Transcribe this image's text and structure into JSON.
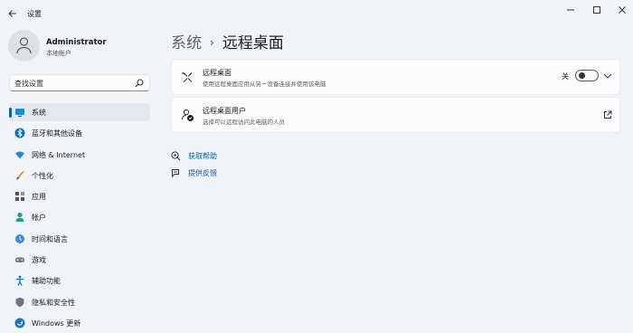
{
  "window": {
    "title": "设置",
    "back_icon": "back-arrow-icon",
    "controls": [
      "minimize-icon",
      "maximize-icon",
      "close-icon"
    ]
  },
  "profile": {
    "name": "Administrator",
    "account_type": "本地帐户"
  },
  "search": {
    "placeholder": "查找设置",
    "value": ""
  },
  "sidebar": {
    "items": [
      {
        "label": "系统",
        "icon": "display-icon",
        "active": true
      },
      {
        "label": "蓝牙和其他设备",
        "icon": "bluetooth-icon",
        "active": false
      },
      {
        "label": "网络 & Internet",
        "icon": "wifi-icon",
        "active": false
      },
      {
        "label": "个性化",
        "icon": "brush-icon",
        "active": false
      },
      {
        "label": "应用",
        "icon": "apps-icon",
        "active": false
      },
      {
        "label": "帐户",
        "icon": "person-icon",
        "active": false
      },
      {
        "label": "时间和语言",
        "icon": "globe-clock-icon",
        "active": false
      },
      {
        "label": "游戏",
        "icon": "gamepad-icon",
        "active": false
      },
      {
        "label": "辅助功能",
        "icon": "accessibility-icon",
        "active": false
      },
      {
        "label": "隐私和安全性",
        "icon": "shield-icon",
        "active": false
      },
      {
        "label": "Windows 更新",
        "icon": "update-icon",
        "active": false
      }
    ]
  },
  "breadcrumb": {
    "parent": "系统",
    "separator": "›",
    "current": "远程桌面"
  },
  "settings": {
    "remote_desktop": {
      "title": "远程桌面",
      "description": "使用远程桌面应用从另一设备连接并使用该电脑",
      "toggle_state": "关",
      "toggle_on": false
    },
    "remote_users": {
      "title": "远程桌面用户",
      "description": "选择可以远程访问此电脑的人员"
    }
  },
  "links": {
    "help": "获取帮助",
    "feedback": "提供反馈"
  },
  "colors": {
    "accent": "#0067c0",
    "link": "#0063b1",
    "background": "#f0f4f9"
  }
}
